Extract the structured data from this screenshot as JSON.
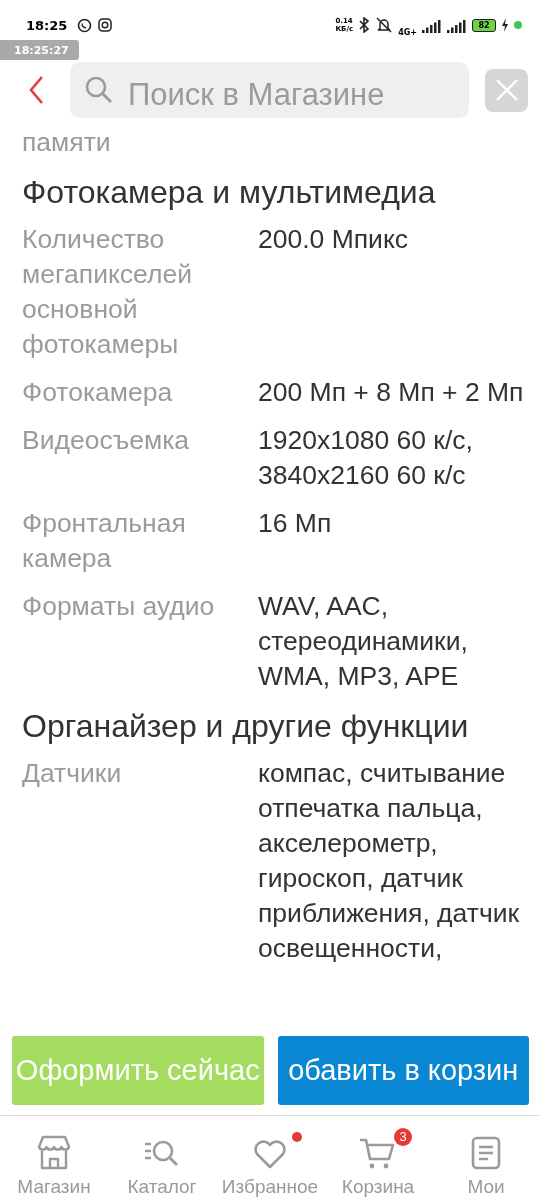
{
  "status_bar": {
    "time": "18:25",
    "net_speed": "0.14",
    "net_unit": "КБ/с",
    "network": "4G+",
    "battery": "82"
  },
  "timestamp_overlay": "18:25:27",
  "search": {
    "placeholder": "Поиск в Магазине"
  },
  "specs": {
    "cut_label": "памяти",
    "sections": [
      {
        "title": "Фотокамера и мультимедиа",
        "rows": [
          {
            "label": "Количество мегапикселей основной фотокамеры",
            "value": "200.0 Мпикс"
          },
          {
            "label": "Фотокамера",
            "value": "200 Мп + 8 Мп + 2 Мп"
          },
          {
            "label": "Видеосъемка",
            "value": "1920x1080 60 к/с, 3840x2160 60 к/с"
          },
          {
            "label": "Фронтальная камера",
            "value": "16 Мп"
          },
          {
            "label": "Форматы аудио",
            "value": "WAV, AAC, стереодинамики, WMA, MP3, APE"
          }
        ]
      },
      {
        "title": "Органайзер и другие функции",
        "rows": [
          {
            "label": "Датчики",
            "value": "компас, считывание отпечатка пальца, акселерометр, гироскоп, датчик приближения, датчик освещенности,"
          }
        ]
      }
    ]
  },
  "actions": [
    {
      "kind": "checkout",
      "label": "Оформить сейчас"
    },
    {
      "kind": "cart",
      "label": "обавить в корзин"
    }
  ],
  "nav": [
    {
      "kind": "store",
      "label": "Магазин"
    },
    {
      "kind": "catalog",
      "label": "Каталог"
    },
    {
      "kind": "favorites",
      "label": "Избранное",
      "dot": true
    },
    {
      "kind": "cart",
      "label": "Корзина",
      "badge": "3"
    },
    {
      "kind": "mine",
      "label": "Мои"
    }
  ]
}
